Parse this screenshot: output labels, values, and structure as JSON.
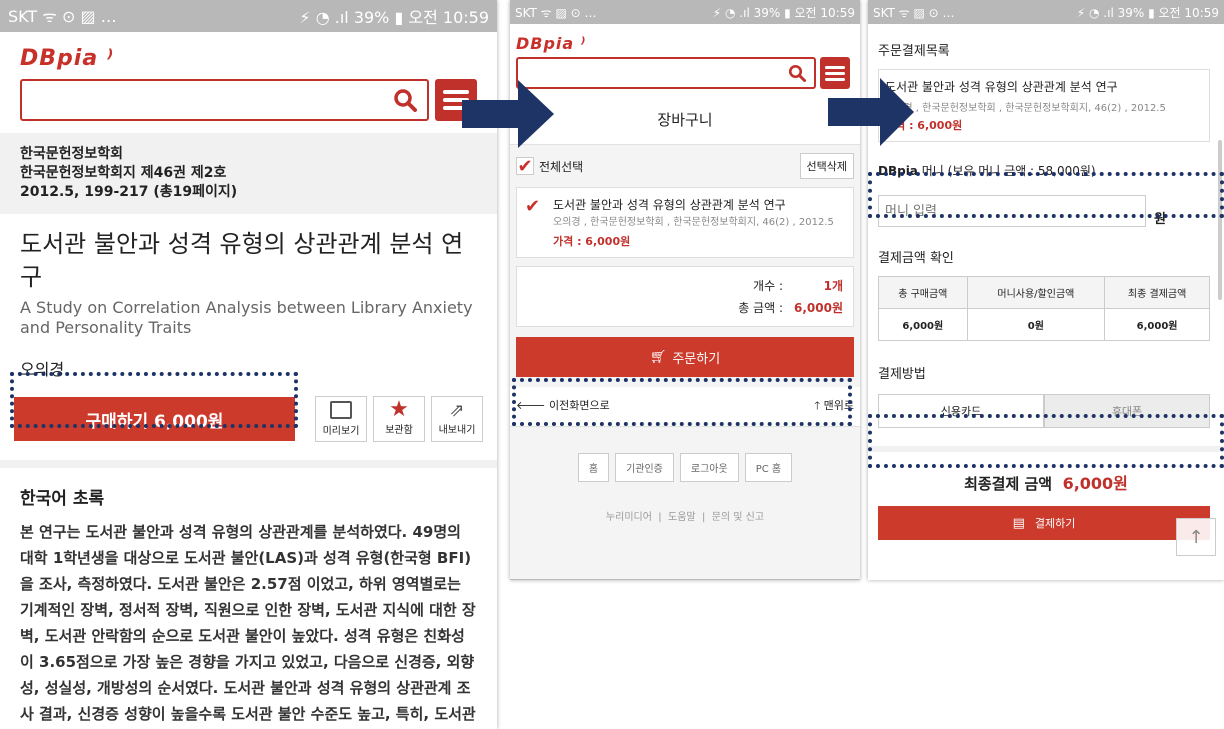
{
  "statusbar": {
    "carrier": "SKT",
    "battery": "39%",
    "time": "오전 10:59"
  },
  "logo": "DBpia",
  "screen1": {
    "publisher": "한국문헌정보학회",
    "journal": "한국문헌정보학회지 제46권 제2호",
    "pages": "2012.5, 199-217 (총19페이지)",
    "title_ko": "도서관 불안과 성격 유형의 상관관계 분석 연구",
    "title_en": "A Study on Correlation Analysis between Library Anxiety and Personality Traits",
    "author": "오의경",
    "buy_label": "구매하기 6,000원",
    "actions": [
      "미리보기",
      "보관함",
      "내보내기"
    ],
    "abstract_heading": "한국어 초록",
    "abstract": "본 연구는 도서관 불안과 성격 유형의 상관관계를 분석하였다. 49명의 대학 1학년생을 대상으로 도서관 불안(LAS)과 성격 유형(한국형 BFI)을 조사, 측정하였다. 도서관 불안은 2.57점 이었고, 하위 영역별로는 기계적인 장벽, 정서적 장벽, 직원으로 인한 장벽, 도서관 지식에 대한 장벽, 도서관 안락함의 순으로 도서관 불안이 높았다. 성격 유형은 친화성이 3.65점으로 가장 높은 경향을 가지고 있었고, 다음으로 신경증, 외향성, 성실성, 개방성의 순서였다. 도서관 불안과 성격 유형의 상관관계 조사 결과, 신경증 성향이 높을수록 도서관 불안 수준도 높고, 특히, 도서관의 안락함 영역과 상관관계가 높은 것으로 나"
  },
  "screen2": {
    "heading": "장바구니",
    "select_all": "전체선택",
    "delete_selected": "선택삭제",
    "item_title": "도서관 불안과 성격 유형의 상관관계 분석 연구",
    "item_meta": "오의경 , 한국문헌정보학회 , 한국문헌정보학회지, 46(2) , 2012.5",
    "item_price": "가격 : 6,000원",
    "count_label": "개수 :",
    "count_value": "1개",
    "total_label": "총 금액 :",
    "total_value": "6,000원",
    "order_label": "주문하기",
    "back_label": "이전화면으로",
    "top_label": "맨위로",
    "footer_buttons": [
      "홈",
      "기관인증",
      "로그아웃",
      "PC 홈"
    ],
    "footer_links": [
      "누리미디어",
      "도움말",
      "문의 및 신고"
    ]
  },
  "screen3": {
    "section_title": "주문결제목록",
    "item_title": "도서관 불안과 성격 유형의 상관관계 분석 연구",
    "item_meta": "오의경 , 한국문헌정보학회 , 한국문헌정보학회지, 46(2) , 2012.5",
    "item_price": "가격 : 6,000원",
    "money_brand": "DBpia",
    "money_label": "머니",
    "money_balance": "(보유 머니 금액 : 58,000원)",
    "money_placeholder": "머니 입력",
    "won": "원",
    "confirm_title": "결제금액 확인",
    "table_headers": [
      "총 구매금액",
      "머니사용/할인금액",
      "최종 결제금액"
    ],
    "table_values": [
      "6,000원",
      "0원",
      "6,000원"
    ],
    "method_title": "결제방법",
    "methods": [
      "신용카드",
      "휴대폰"
    ],
    "final_label": "최종결제 금액",
    "final_value": "6,000원",
    "pay_label": "결제하기"
  },
  "colors": {
    "brand_red": "#c0312b",
    "navy": "#1e3466",
    "statusbar": "#b8b8b8"
  }
}
